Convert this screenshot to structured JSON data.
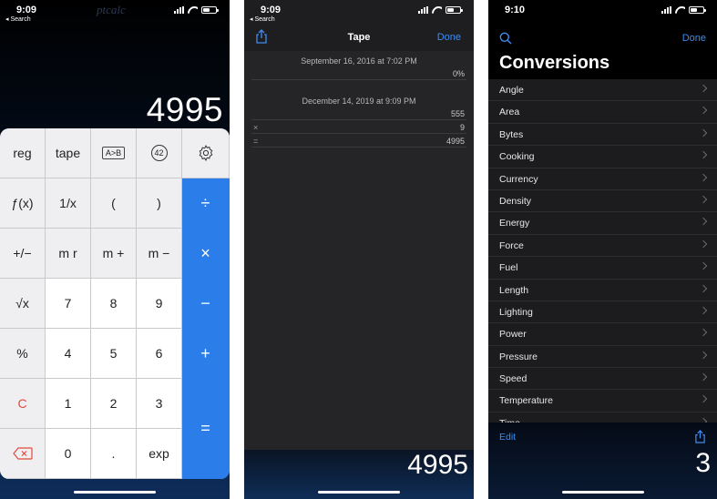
{
  "screen1": {
    "time": "9:09",
    "back_label": "◂ Search",
    "watermark": "ptcalc",
    "display": "4995",
    "keys": {
      "reg": "reg",
      "tape": "tape",
      "ab": "A>B",
      "n42": "42",
      "fx": "ƒ(x)",
      "recip": "1/x",
      "lparen": "(",
      "rparen": ")",
      "divide": "÷",
      "plusminus": "+/−",
      "mr": "m r",
      "mplus": "m +",
      "mminus": "m −",
      "multiply": "×",
      "sqrt": "√x",
      "k7": "7",
      "k8": "8",
      "k9": "9",
      "minus": "−",
      "percent": "%",
      "k4": "4",
      "k5": "5",
      "k6": "6",
      "plus": "+",
      "clear": "C",
      "k1": "1",
      "k2": "2",
      "k3": "3",
      "equals": "=",
      "k0": "0",
      "dot": ".",
      "exp": "exp"
    }
  },
  "screen2": {
    "time": "9:09",
    "back_label": "◂ Search",
    "nav_title": "Tape",
    "done_label": "Done",
    "entries": [
      {
        "date": "September 16, 2016 at 7:02 PM",
        "rows": [
          {
            "op": "",
            "value": "0%"
          }
        ]
      },
      {
        "date": "December 14, 2019 at 9:09 PM",
        "rows": [
          {
            "op": "",
            "value": "555"
          },
          {
            "op": "×",
            "value": "9"
          },
          {
            "op": "=",
            "value": "4995"
          }
        ]
      }
    ],
    "display": "4995"
  },
  "screen3": {
    "time": "9:10",
    "done_label": "Done",
    "title": "Conversions",
    "items": [
      "Angle",
      "Area",
      "Bytes",
      "Cooking",
      "Currency",
      "Density",
      "Energy",
      "Force",
      "Fuel",
      "Length",
      "Lighting",
      "Power",
      "Pressure",
      "Speed",
      "Temperature",
      "Time"
    ],
    "edit_label": "Edit",
    "display": "3"
  },
  "colors": {
    "accent_blue": "#2b7ee9",
    "link_blue": "#3d8cf0",
    "clear_red": "#e04a3a"
  }
}
